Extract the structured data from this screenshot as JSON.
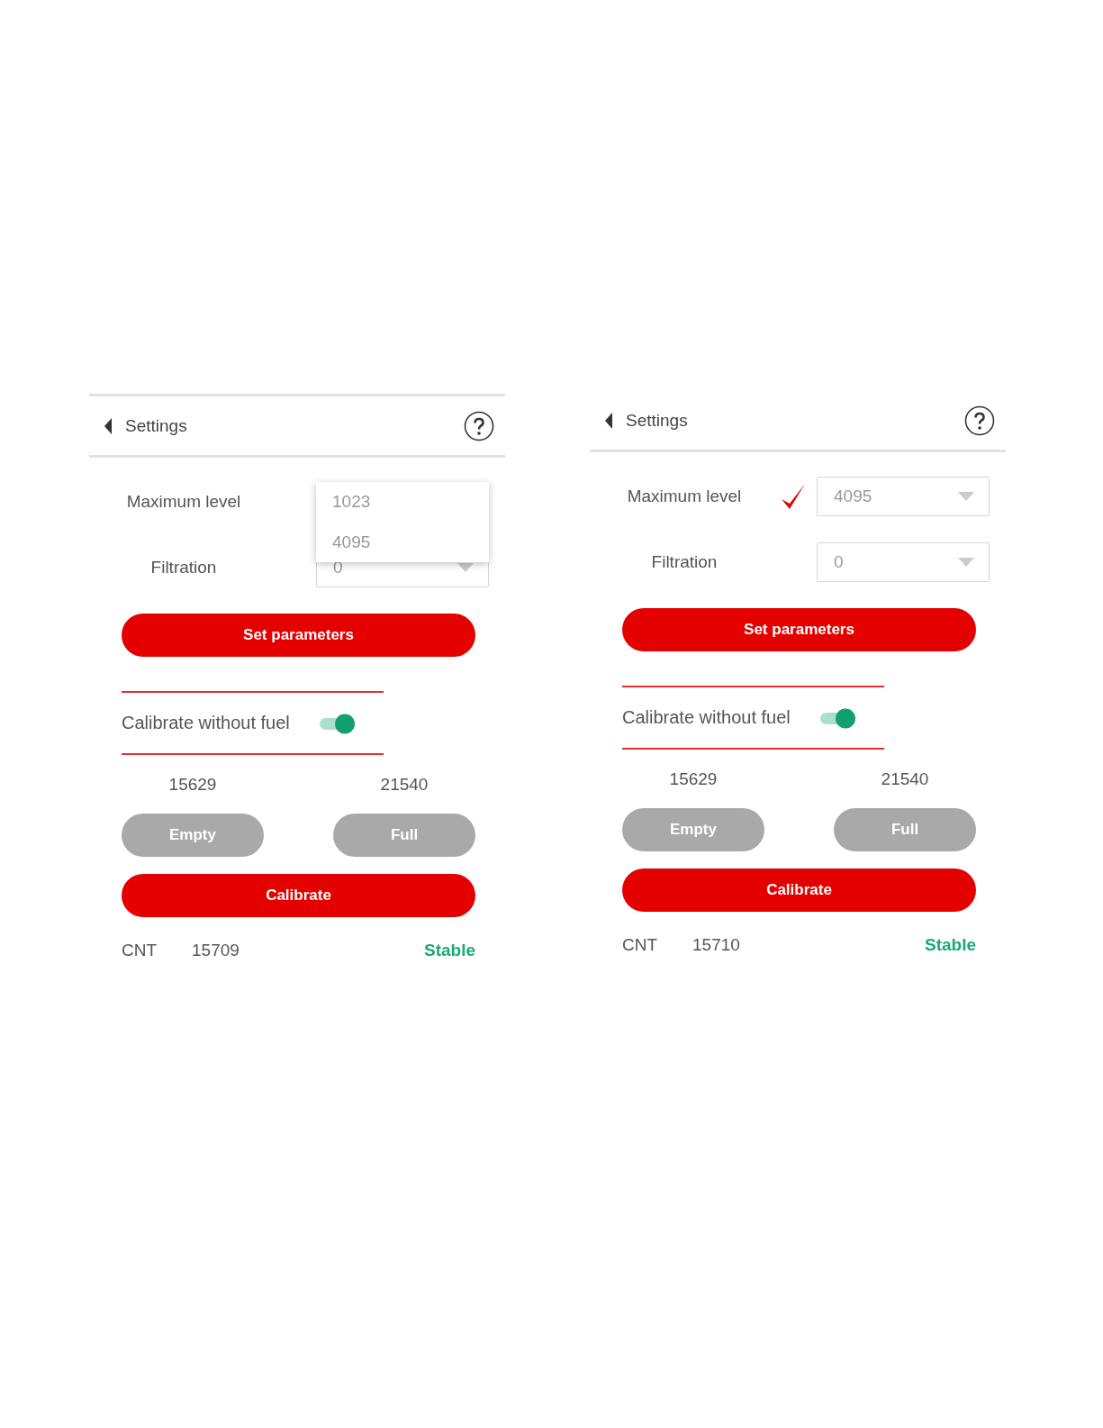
{
  "panels": [
    {
      "header": {
        "title": "Settings"
      },
      "fields": [
        {
          "label": "Maximum level",
          "confirmed": false,
          "menu": [
            {
              "label": "1023",
              "selected": false
            },
            {
              "label": "4095",
              "selected": false
            }
          ]
        },
        {
          "label": "Filtration",
          "value": "0",
          "confirmed": false
        }
      ],
      "set_button": "Set parameters",
      "toggle": {
        "label": "Calibrate without fuel",
        "on": true
      },
      "readings": [
        "15629",
        "21540"
      ],
      "point_buttons": [
        "Empty",
        "Full"
      ],
      "calibrate_button": "Calibrate",
      "status": {
        "label": "CNT",
        "count": "15709",
        "state": "Stable"
      }
    },
    {
      "header": {
        "title": "Settings"
      },
      "fields": [
        {
          "label": "Maximum level",
          "value": "4095",
          "confirmed": true
        },
        {
          "label": "Filtration",
          "value": "0",
          "confirmed": false
        }
      ],
      "set_button": "Set parameters",
      "toggle": {
        "label": "Calibrate without fuel",
        "on": true
      },
      "readings": [
        "15629",
        "21540"
      ],
      "point_buttons": [
        "Empty",
        "Full"
      ],
      "calibrate_button": "Calibrate",
      "status": {
        "label": "CNT",
        "count": "15710",
        "state": "Stable"
      }
    }
  ]
}
